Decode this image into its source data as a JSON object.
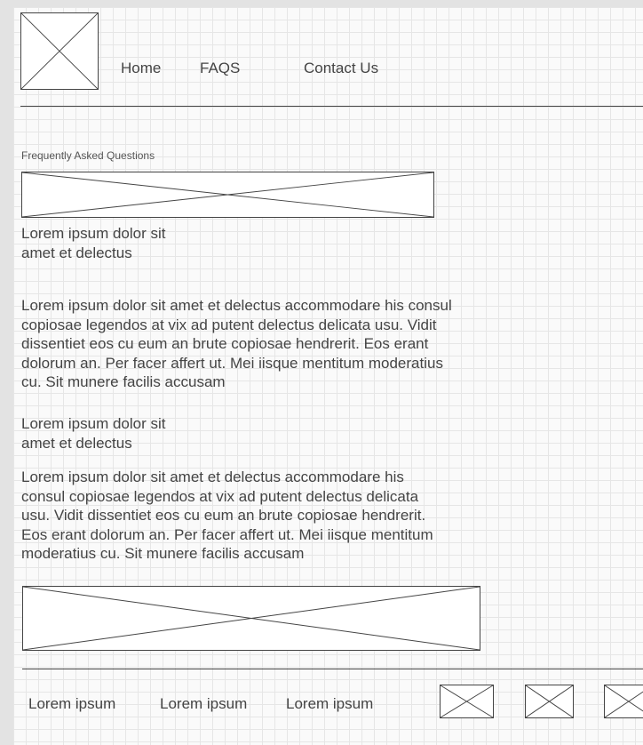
{
  "header": {
    "logo_icon": "image-placeholder-icon",
    "nav": [
      {
        "label": "Home"
      },
      {
        "label": "FAQS"
      },
      {
        "label": "Contact Us"
      }
    ]
  },
  "main": {
    "section_title": "Frequently Asked Questions",
    "banner_icon": "image-placeholder-icon",
    "faqs": [
      {
        "question": "Lorem ipsum dolor sit amet et delectus",
        "answer": "Lorem ipsum dolor sit amet et delectus accommodare his consul copiosae legendos at vix ad putent delectus delicata usu. Vidit dissentiet eos cu eum an brute copiosae hendrerit. Eos erant dolorum an. Per facer affert ut. Mei iisque mentitum moderatius cu. Sit munere facilis accusam"
      },
      {
        "question": "Lorem ipsum dolor sit amet et delectus",
        "answer": "Lorem ipsum dolor sit amet et delectus accommodare his consul copiosae legendos at vix ad putent delectus delicata usu. Vidit dissentiet eos cu eum an brute copiosae hendrerit. Eos erant dolorum an. Per facer affert ut. Mei iisque mentitum moderatius cu. Sit munere facilis accusam"
      }
    ],
    "bottom_banner_icon": "image-placeholder-icon"
  },
  "footer": {
    "links": [
      {
        "label": "Lorem ipsum"
      },
      {
        "label": "Lorem ipsum"
      },
      {
        "label": "Lorem ipsum"
      }
    ],
    "social_icons": [
      "image-placeholder-icon",
      "image-placeholder-icon",
      "image-placeholder-icon"
    ]
  }
}
